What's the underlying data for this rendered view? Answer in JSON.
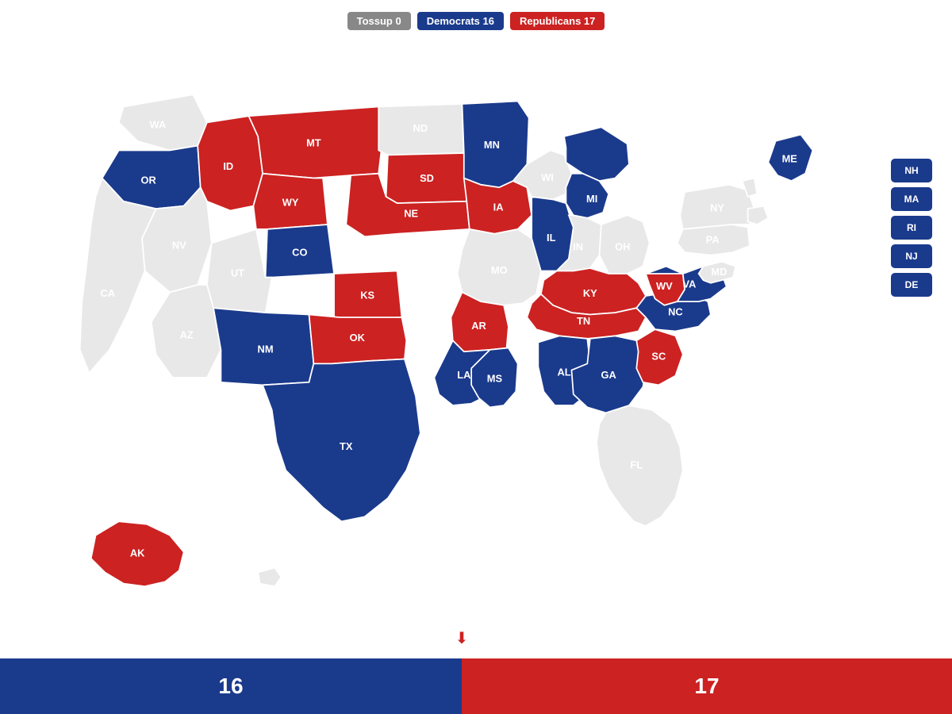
{
  "legend": {
    "tossup_label": "Tossup 0",
    "dem_label": "Democrats 16",
    "rep_label": "Republicans 17"
  },
  "colors": {
    "dem": "#1a3a8c",
    "rep": "#cc2222",
    "neutral": "#e8e8e8",
    "tossup": "#888888"
  },
  "scores": {
    "dem": "16",
    "rep": "17",
    "dem_pct": 48.5,
    "rep_pct": 51.5
  },
  "small_states": [
    {
      "abbr": "NH",
      "party": "dem"
    },
    {
      "abbr": "MA",
      "party": "dem"
    },
    {
      "abbr": "RI",
      "party": "dem"
    },
    {
      "abbr": "NJ",
      "party": "dem"
    },
    {
      "abbr": "DE",
      "party": "dem"
    }
  ]
}
